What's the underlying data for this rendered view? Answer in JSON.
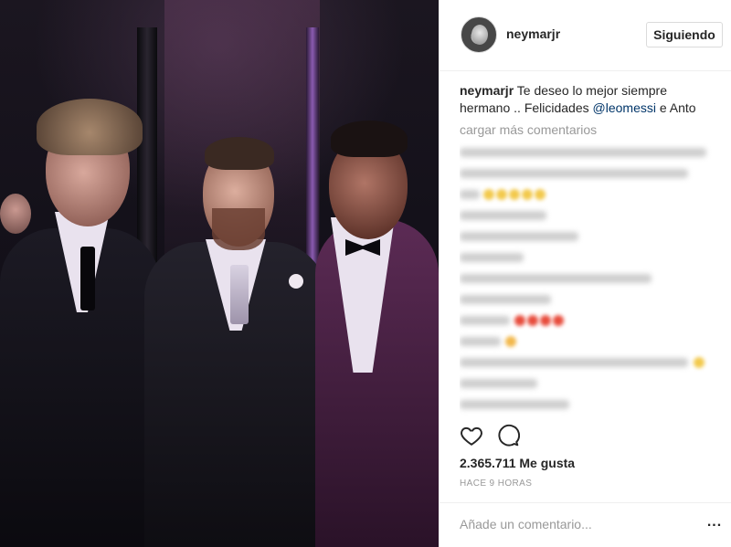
{
  "post": {
    "username": "neymarjr",
    "follow_label": "Siguiendo",
    "caption": {
      "username": "neymarjr",
      "text_before": " Te deseo lo mejor siempre hermano .. Felicidades ",
      "mention": "@leomessi",
      "text_after": " e Anto"
    },
    "load_more_label": "cargar más comentarios",
    "likes_count": "2.365.711 Me gusta",
    "timestamp": "HACE 9 HORAS",
    "add_comment_placeholder": "Añade un comentario...",
    "more_options_label": "..."
  },
  "icons": {
    "like": "heart-icon",
    "comment": "comment-bubble-icon",
    "more": "more-options-icon"
  },
  "colors": {
    "text": "#262626",
    "muted": "#999999",
    "mention": "#003569",
    "border": "#dbdbdb"
  }
}
